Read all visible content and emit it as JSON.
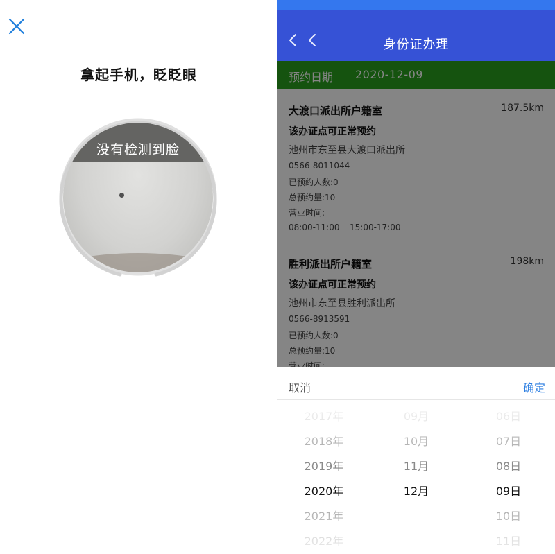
{
  "face_scan": {
    "title": "拿起手机，眨眨眼",
    "camera_message": "没有检测到脸",
    "close_icon": "close-icon"
  },
  "app": {
    "nav_title": "身份证办理",
    "back_icon": "chevron-left-icon",
    "date_label": "预约日期",
    "date_value": "2020-12-09",
    "colors": {
      "nav": "#3652d6",
      "status": "#3477ee",
      "date_bar": "#2aa01e",
      "confirm": "#2a7de1"
    }
  },
  "offices": [
    {
      "name": "大渡口派出所户籍室",
      "distance": "187.5km",
      "status": "该办证点可正常预约",
      "address": "池州市东至县大渡口派出所",
      "phone": "0566-8011044",
      "booked": "已预约人数:0",
      "total": "总预约量:10",
      "hours_label": "营业时间:",
      "hours_am": "08:00-11:00",
      "hours_pm": "15:00-17:00"
    },
    {
      "name": "胜利派出所户籍室",
      "distance": "198km",
      "status": "该办证点可正常预约",
      "address": "池州市东至县胜利派出所",
      "phone": "0566-8913591",
      "booked": "已预约人数:0",
      "total": "总预约量:10",
      "hours_label": "营业时间:"
    }
  ],
  "picker": {
    "cancel": "取消",
    "confirm": "确定",
    "years": [
      "2017年",
      "2018年",
      "2019年",
      "2020年",
      "2021年",
      "2022年"
    ],
    "months": [
      "09月",
      "10月",
      "11月",
      "12月"
    ],
    "days": [
      "06日",
      "07日",
      "08日",
      "09日",
      "10日",
      "11日"
    ],
    "selected": {
      "year": "2020年",
      "month": "12月",
      "day": "09日"
    }
  }
}
